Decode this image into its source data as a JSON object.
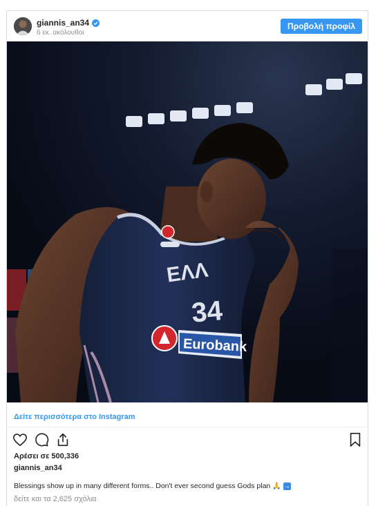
{
  "post": {
    "username": "giannis_an34",
    "followers": "6 εκ. ακόλουθοι",
    "profile_button": "Προβολή προφίλ",
    "see_more_link": "Δείτε περισσότερα στο Instagram",
    "likes": "Αρέσει σε 500,336",
    "caption_username": "giannis_an34",
    "caption": "Blessings show up in many different forms.. Don't ever second guess Gods plan",
    "comments": "δείτε και τα 2,625 σχόλια"
  },
  "photo": {
    "jersey_number": "34",
    "jersey_letters": "ΕΛΛ",
    "sponsor": "Eurobank"
  },
  "icons": [
    "verified-badge-icon",
    "heart-icon",
    "comment-icon",
    "share-icon",
    "bookmark-icon",
    "pray-emoji-icon",
    "arrow-emoji-icon"
  ],
  "colors": {
    "accent": "#3897f0",
    "muted": "#8e8e8e",
    "jersey": "#1f2d4f",
    "sponsor_red": "#d3272e"
  }
}
